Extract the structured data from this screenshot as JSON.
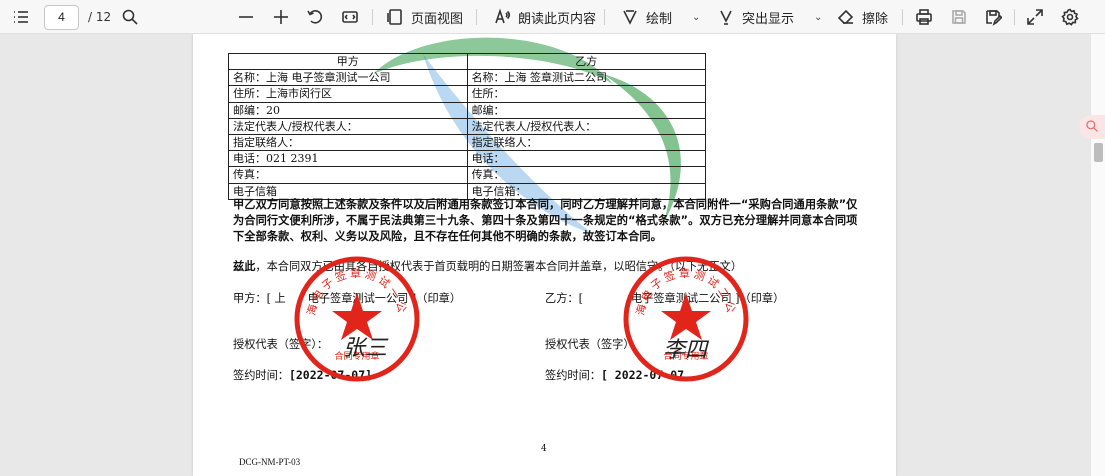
{
  "toolbar": {
    "page_current": "4",
    "page_total": "/ 12",
    "page_view_label": "页面视图",
    "read_aloud_label": "朗读此页内容",
    "draw_label": "绘制",
    "highlight_label": "突出显示",
    "erase_label": "擦除",
    "icons": [
      "contents-icon",
      "search-icon",
      "zoom-out-icon",
      "zoom-in-icon",
      "rotate-icon",
      "fit-page-icon",
      "page-view-icon",
      "read-aloud-icon",
      "draw-icon",
      "highlight-icon",
      "eraser-icon",
      "print-icon",
      "save-icon",
      "save-as-icon",
      "fullscreen-icon",
      "settings-icon"
    ]
  },
  "table": {
    "header": [
      "甲方",
      "乙方"
    ],
    "rows": [
      [
        "名称：上海      电子签章测试一公司",
        "名称：上海          签章测试二公司"
      ],
      [
        "住所：上海市闵行区",
        "住所："
      ],
      [
        "邮编：20",
        "邮编："
      ],
      [
        "法定代表人/授权代表人：",
        "法定代表人/授权代表人："
      ],
      [
        "指定联络人：",
        "指定联络人："
      ],
      [
        "电话：021     2391",
        "电话："
      ],
      [
        "传真：",
        "传真："
      ],
      [
        "电子信箱",
        "电子信箱："
      ]
    ]
  },
  "paragraph": "甲乙双方同意按照上述条款及条件以及后附通用条款签订本合同，同时乙方理解并同意，本合同附件一“采购合同通用条款”仅为合同行文便利所涉，不属于民法典第三十九条、第四十条及第四十一条规定的“格式条款”。双方已充分理解并同意本合同项下全部条款、权利、义务以及风险，且不存在任何其他不明确的条款，故签订本合同。",
  "witness": {
    "lead": "兹此",
    "text": "，本合同双方已由其各自授权代表于首页载明的日期签署本合同并盖章，以昭信守。（以下无正文）"
  },
  "party_a": {
    "label": "甲方：[ 上",
    "name_tail": "电子签章测试一公司 ]（印章）",
    "rep_label": "授权代表（签字）：",
    "signature": "张三",
    "date_label": "签约时间：",
    "date_value": "[2022-07-07]",
    "stamp_text": "上海电子签章测试一公司",
    "stamp_sub": "合同专用章"
  },
  "party_b": {
    "label": "乙方：[",
    "name_tail": "电子签章测试二公司 ]（印章）",
    "rep_label": "授权代表（签字）：",
    "signature": "李四",
    "date_label": "签约时间：",
    "date_value": "[ 2022-07-07",
    "stamp_text": "上海电子签章测试二公司",
    "stamp_sub": "合同专用章"
  },
  "page_number": "4",
  "doc_code": "DCG-NM-PT-03",
  "colors": {
    "stamp_red": "#e1251b",
    "toolbar_bg": "#f7f7f7",
    "watermark_green": "#2e9b46",
    "watermark_blue": "#3a8fd8"
  }
}
